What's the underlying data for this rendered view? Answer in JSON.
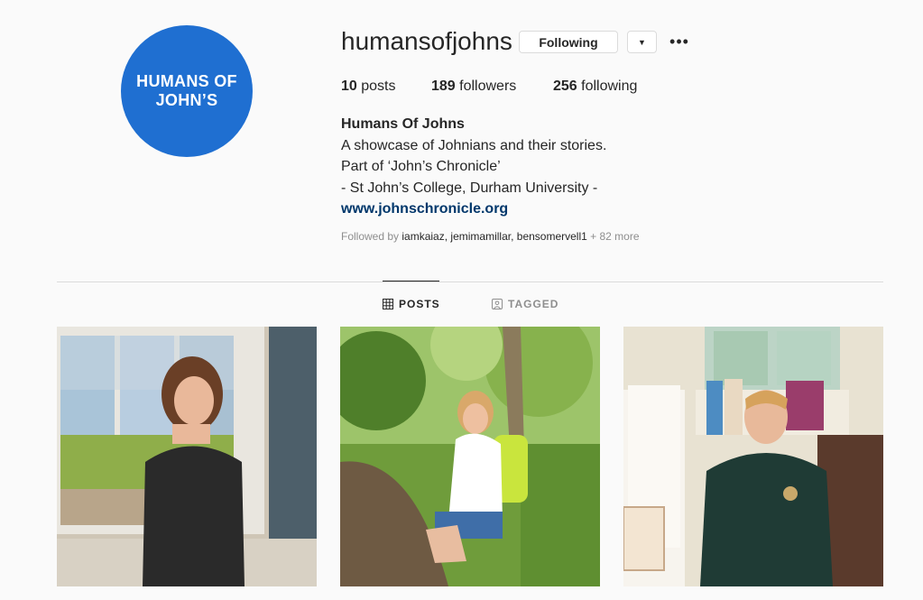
{
  "profile": {
    "avatar_text": [
      "HUMANS OF",
      "JOHN’S"
    ],
    "username": "humansofjohns",
    "following_button": "Following",
    "dropdown_icon": "▼",
    "more_icon": "•••"
  },
  "stats": {
    "posts_count": "10",
    "posts_label": " posts",
    "followers_count": "189",
    "followers_label": " followers",
    "following_count": "256",
    "following_label": " following"
  },
  "bio": {
    "name": "Humans Of Johns",
    "lines": [
      "A showcase of Johnians and their stories.",
      "Part of ‘John’s Chronicle’",
      "- St John’s College, Durham University -"
    ],
    "link": "www.johnschronicle.org"
  },
  "followed_by": {
    "prefix": "Followed by ",
    "users": [
      "iamkaiaz",
      "jemimamillar",
      "bensomervell1"
    ],
    "suffix": " + 82 more"
  },
  "tabs": {
    "posts": "POSTS",
    "tagged": "TAGGED"
  },
  "colors": {
    "avatar_bg": "#1f6fd1",
    "link": "#00376b",
    "muted": "#8e8e8e"
  },
  "posts": [
    {
      "icon": "photo-woman-by-window"
    },
    {
      "icon": "photo-woman-hiking-forest"
    },
    {
      "icon": "photo-man-in-room"
    }
  ]
}
